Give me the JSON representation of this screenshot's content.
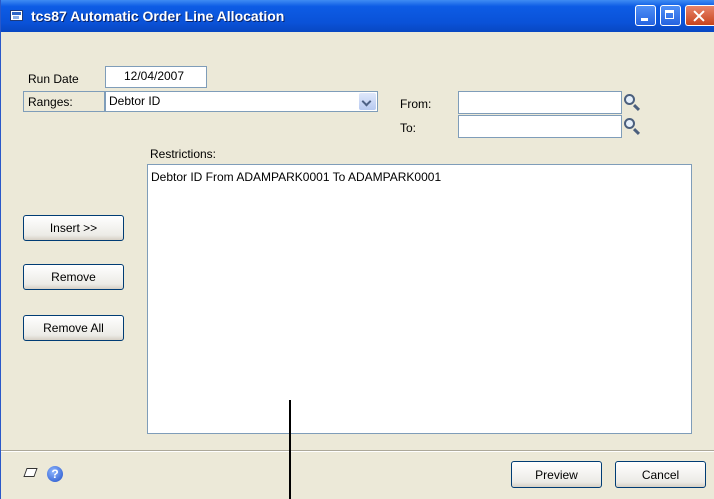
{
  "window": {
    "title": "tcs87 Automatic Order Line Allocation"
  },
  "form": {
    "run_date_label": "Run Date",
    "run_date_value": "12/04/2007",
    "ranges_label": "Ranges:",
    "ranges_selected": "Debtor ID",
    "from_label": "From:",
    "from_value": "",
    "to_label": "To:",
    "to_value": "",
    "restrictions_label": "Restrictions:",
    "restrictions": [
      "Debtor ID From ADAMPARK0001 To  ADAMPARK0001"
    ]
  },
  "buttons": {
    "insert": "Insert >>",
    "remove": "Remove",
    "remove_all": "Remove All",
    "preview": "Preview",
    "cancel": "Cancel"
  },
  "icons": {
    "title_icon": "window-form-icon",
    "lookup": "magnifier-icon",
    "note": "note-icon",
    "help": "help-icon"
  }
}
